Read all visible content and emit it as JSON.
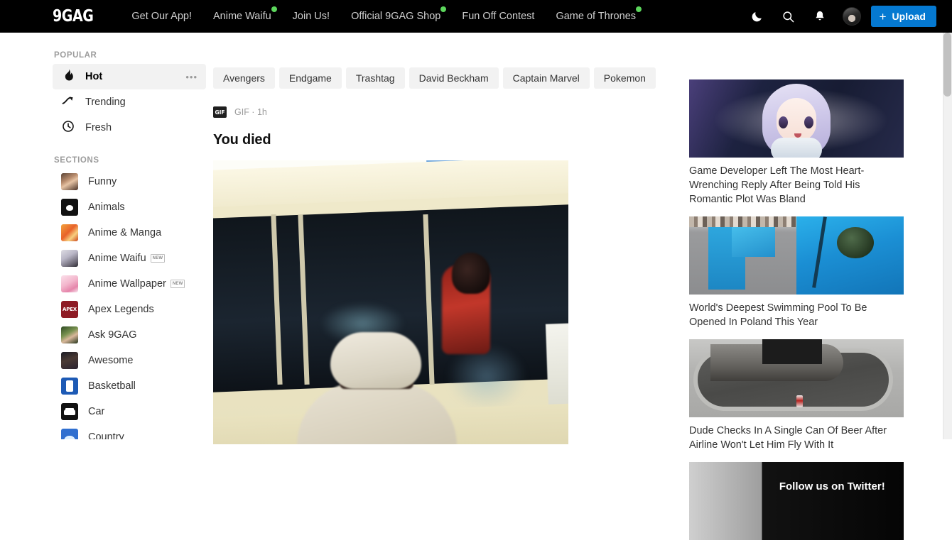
{
  "header": {
    "brand": "9GAG",
    "nav": [
      {
        "label": "Get Our App!",
        "dot": false
      },
      {
        "label": "Anime Waifu",
        "dot": true
      },
      {
        "label": "Join Us!",
        "dot": false
      },
      {
        "label": "Official 9GAG Shop",
        "dot": true
      },
      {
        "label": "Fun Off Contest",
        "dot": false
      },
      {
        "label": "Game of Thrones",
        "dot": true
      }
    ],
    "icons": {
      "dark_mode": "moon-icon",
      "search": "search-icon",
      "notifications": "bell-icon",
      "avatar": "user-avatar"
    },
    "upload": {
      "plus": "+",
      "label": "Upload"
    },
    "accent_color": "#0579d1",
    "dot_color": "#5cd65c",
    "background": "#000000"
  },
  "sidebar": {
    "popular_heading": "POPULAR",
    "popular": [
      {
        "label": "Hot",
        "icon": "flame-icon",
        "active": true,
        "menu": "•••"
      },
      {
        "label": "Trending",
        "icon": "trending-up-icon",
        "active": false
      },
      {
        "label": "Fresh",
        "icon": "clock-icon",
        "active": false
      }
    ],
    "sections_heading": "SECTIONS",
    "sections": [
      {
        "label": "Funny",
        "thumb": "t-funny",
        "badge": ""
      },
      {
        "label": "Animals",
        "thumb": "t-animals",
        "badge": ""
      },
      {
        "label": "Anime & Manga",
        "thumb": "t-manga",
        "badge": ""
      },
      {
        "label": "Anime Waifu",
        "thumb": "t-waifu",
        "badge": "NEW"
      },
      {
        "label": "Anime Wallpaper",
        "thumb": "t-wall",
        "badge": "NEW"
      },
      {
        "label": "Apex Legends",
        "thumb": "t-apex",
        "badge": ""
      },
      {
        "label": "Ask 9GAG",
        "thumb": "t-ask",
        "badge": ""
      },
      {
        "label": "Awesome",
        "thumb": "t-awesome",
        "badge": ""
      },
      {
        "label": "Basketball",
        "thumb": "t-basket",
        "badge": ""
      },
      {
        "label": "Car",
        "thumb": "t-car",
        "badge": ""
      },
      {
        "label": "Country",
        "thumb": "t-country",
        "badge": ""
      }
    ]
  },
  "main": {
    "tags": [
      "Avengers",
      "Endgame",
      "Trashtag",
      "David Beckham",
      "Captain Marvel",
      "Pokemon"
    ],
    "post": {
      "type_badge": "GIF",
      "meta": "GIF · 1h",
      "title": "You died",
      "media_alt": "man-in-cap-at-bus-window"
    }
  },
  "rail": {
    "cards": [
      {
        "title": "Game Developer Left The Most Heart-Wrenching Reply After Being Told His Romantic Plot Was Bland",
        "image": "anime-girl-thumbnail"
      },
      {
        "title": "World's Deepest Swimming Pool To Be Opened In Poland This Year",
        "image": "swimming-pool-thumbnail"
      },
      {
        "title": "Dude Checks In A Single Can Of Beer After Airline Won't Let Him Fly With It",
        "image": "baggage-carousel-thumbnail"
      },
      {
        "title": "",
        "image": "twitter-banner",
        "banner_text": "Follow us on Twitter!"
      }
    ]
  }
}
